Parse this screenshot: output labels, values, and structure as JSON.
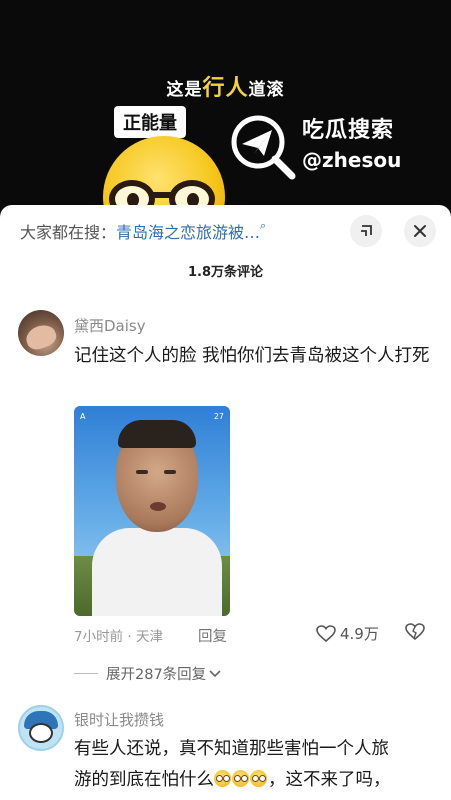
{
  "video": {
    "subtitle_before": "这是",
    "subtitle_highlight": "行人",
    "subtitle_after": "道滚",
    "tag": "正能量",
    "brand_name": "吃瓜搜索",
    "brand_handle": "@zhesou"
  },
  "header": {
    "search_prefix": "大家都在搜：",
    "search_query": "青岛海之恋旅游被…",
    "search_icon": "search-icon",
    "minimize_icon": "minimize-icon",
    "close_icon": "close-icon"
  },
  "comment_count": "1.8万条评论",
  "comments": [
    {
      "username": "黛西Daisy",
      "text": "记住这个人的脸 我怕你们去青岛被这个人打死",
      "image": {
        "status_left": "A",
        "status_right": "27"
      },
      "time_location": "7小时前 · 天津",
      "reply_label": "回复",
      "likes": "4.9万",
      "expand_label": "展开287条回复"
    },
    {
      "username": "银时让我攒钱",
      "text_line1": "有些人还说，真不知道那些害怕一个人旅",
      "text_line2_before": "游的到底在怕什么",
      "text_line2_after": "，这不来了吗，"
    }
  ],
  "colors": {
    "link": "#2f6eb5",
    "highlight": "#f3d23b",
    "muted": "#999999"
  }
}
